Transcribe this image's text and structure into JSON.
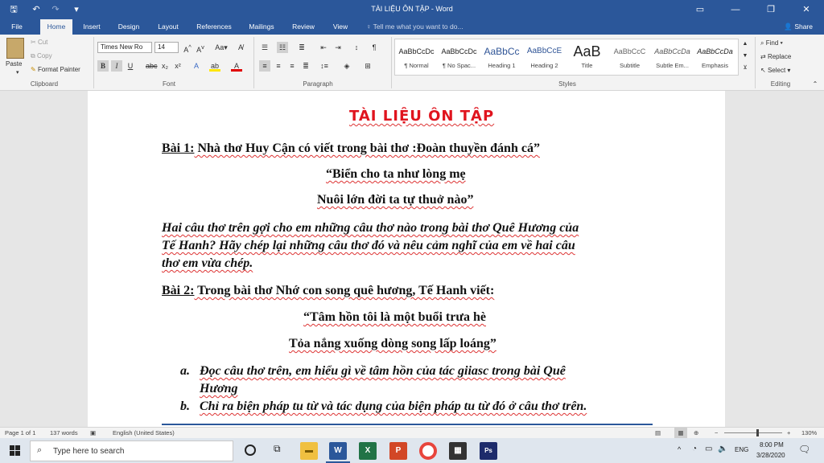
{
  "titlebar": {
    "doc_title": "TÀI LIỆU ÔN TẬP  -  Word",
    "qat": {
      "save": "🖫",
      "undo": "↶",
      "redo": "↷",
      "customize": "▾"
    },
    "win": {
      "ribbon_opts": "▭",
      "minimize": "—",
      "restore": "❐",
      "close": "✕"
    }
  },
  "tabs": [
    "File",
    "Home",
    "Insert",
    "Design",
    "Layout",
    "References",
    "Mailings",
    "Review",
    "View"
  ],
  "tell_me": "♀ Tell me what you want to do...",
  "share": "Share",
  "clipboard": {
    "paste": "Paste",
    "cut": "Cut",
    "copy": "Copy",
    "format_painter": "Format Painter",
    "label": "Clipboard"
  },
  "font": {
    "family": "Times New Ro",
    "size": "14",
    "label": "Font"
  },
  "paragraph": {
    "label": "Paragraph"
  },
  "styles": {
    "label": "Styles",
    "items": [
      {
        "preview": "AaBbCcDc",
        "name": "¶ Normal"
      },
      {
        "preview": "AaBbCcDc",
        "name": "¶ No Spac..."
      },
      {
        "preview": "AaBbCc",
        "name": "Heading 1"
      },
      {
        "preview": "AaBbCcE",
        "name": "Heading 2"
      },
      {
        "preview": "AaB",
        "name": "Title"
      },
      {
        "preview": "AaBbCcC",
        "name": "Subtitle"
      },
      {
        "preview": "AaBbCcDa",
        "name": "Subtle Em..."
      },
      {
        "preview": "AaBbCcDa",
        "name": "Emphasis"
      }
    ]
  },
  "editing": {
    "find": "Find",
    "replace": "Replace",
    "select": "Select",
    "label": "Editing"
  },
  "document": {
    "title": "TÀI LIỆU ÔN TẬP",
    "bai1_label": "Bài 1:",
    "bai1_text": " Nhà thơ Huy Cận có viết trong bài thơ :Đoàn thuyền đánh cá”",
    "quote1_l1": "“Biển cho ta như lòng mẹ",
    "quote1_l2": "Nuôi lớn đời ta tự thuở nào”",
    "q1_l1": "Hai câu thơ trên gợi cho em những câu thơ nào trong bài thơ Quê Hương của",
    "q1_l2": "Tế Hanh? Hãy chép lại những câu thơ đó và nêu cảm nghĩ của em về hai câu",
    "q1_l3": "thơ em vừa chép.",
    "bai2_label": "Bài 2:",
    "bai2_text": " Trong bài thơ Nhớ con song quê hương, Tế Hanh viết:",
    "quote2_l1": "“Tâm hồn tôi là một buổi trưa hè",
    "quote2_l2": "Tỏa nắng xuống dòng song lấp loáng”",
    "item_a_marker": "a.",
    "item_a_l1": "Đọc câu thơ trên, em hiểu gì về tâm hồn của tác giiasc trong bài Quê",
    "item_a_l2": "Hương",
    "item_b_marker": "b.",
    "item_b_l1": "Chỉ ra biện pháp tu từ và tác dụng của biện pháp tu từ đó ở câu thơ trên."
  },
  "status": {
    "page": "Page 1 of 1",
    "words": "137 words",
    "language": "English (United States)",
    "zoom": "130%"
  },
  "taskbar": {
    "search_placeholder": "Type here to search",
    "time": "8:00 PM",
    "date": "3/28/2020",
    "lang": "ENG"
  }
}
